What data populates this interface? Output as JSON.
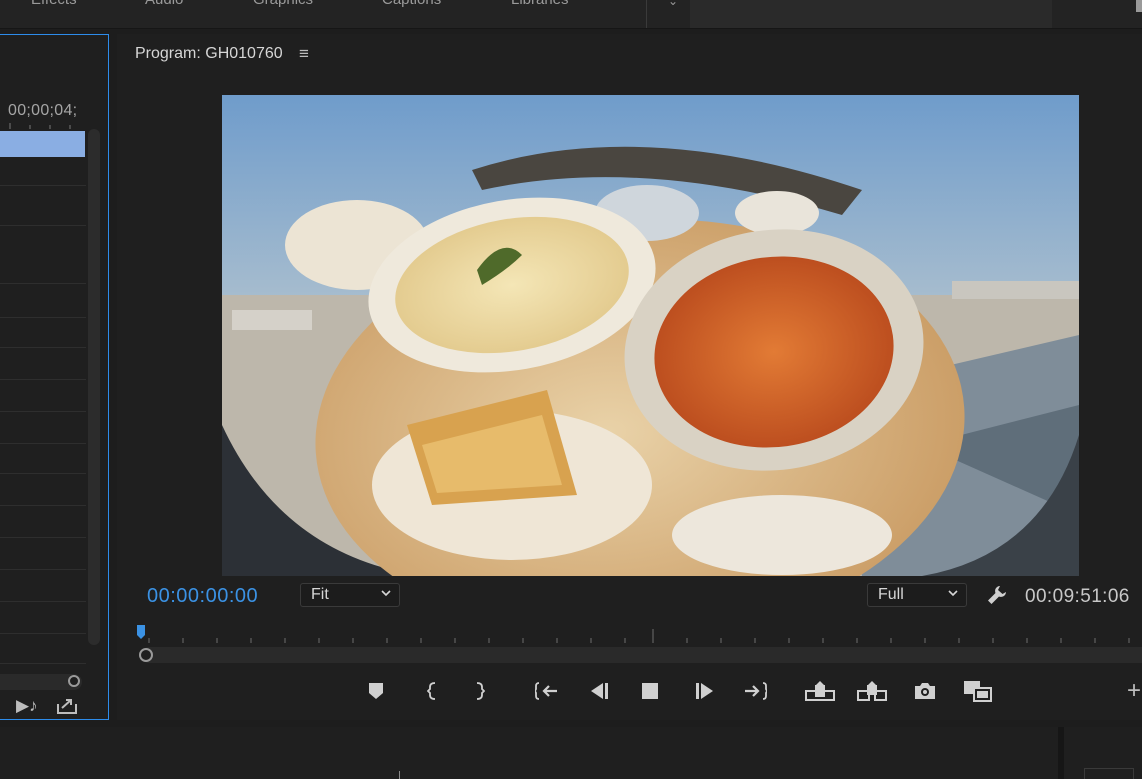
{
  "workspace_tabs": [
    "Effects",
    "Audio",
    "Graphics",
    "Captions",
    "Libraries"
  ],
  "left_panel": {
    "timecode": "00;00;04;",
    "icons": [
      "audio-insert-icon",
      "export-icon"
    ]
  },
  "program_monitor": {
    "title": "Program: GH010760",
    "menu_icon": "hamburger-icon",
    "current_timecode": "00:00:00:00",
    "zoom_select": "Fit",
    "quality_select": "Full",
    "duration_timecode": "00:09:51:06",
    "transport_buttons": [
      "Add Marker",
      "Mark In",
      "Mark Out",
      "Go to In",
      "Step Back",
      "Stop",
      "Step Forward",
      "Go to Out",
      "Lift",
      "Extract",
      "Export Frame",
      "Comparison View"
    ]
  },
  "colors": {
    "accent_blue": "#3b92e4",
    "panel_bg": "#1f1f1f",
    "clip_blue": "#8aaee3",
    "focus_border": "#2d8ceb"
  }
}
